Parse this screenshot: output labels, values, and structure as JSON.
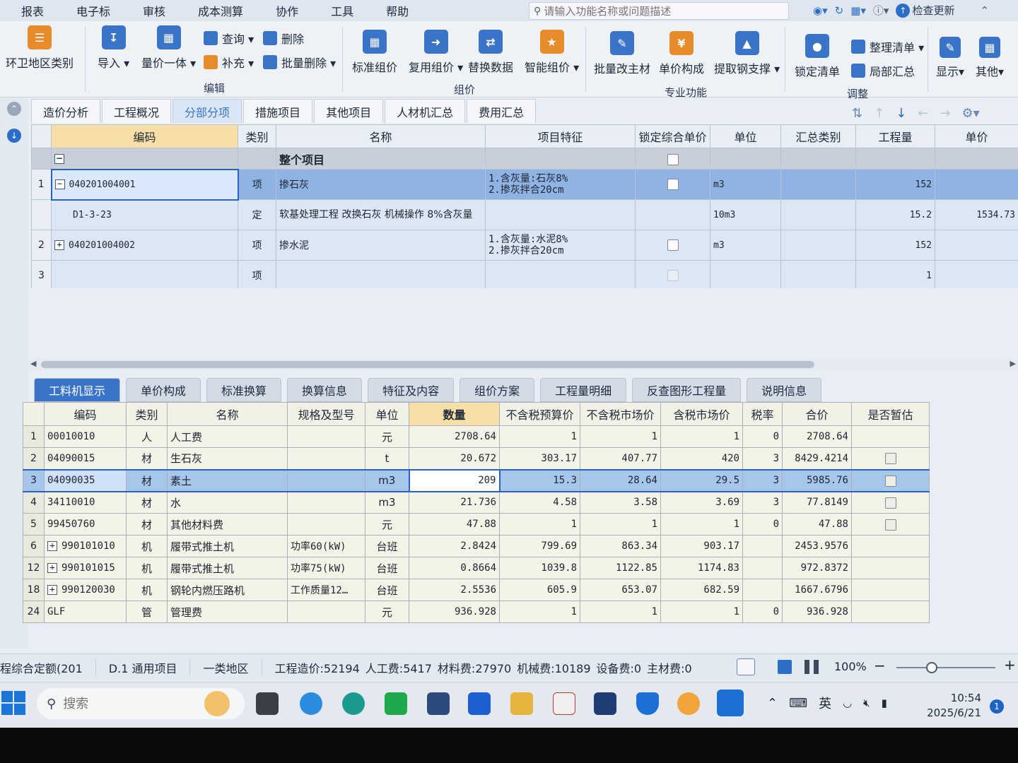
{
  "menu": [
    "报表",
    "电子标",
    "审核",
    "成本测算",
    "协作",
    "工具",
    "帮助"
  ],
  "search": {
    "placeholder": "请输入功能名称或问题描述"
  },
  "topright": {
    "check_update": "检查更新"
  },
  "ribbon": {
    "region_category": "环卫地区类别",
    "import": "导入",
    "quantity_price": "量价一体",
    "query": "查询",
    "supplement": "补充",
    "delete": "删除",
    "batch_delete": "批量删除",
    "group_edit": "编辑",
    "standard_price": "标准组价",
    "reuse_price": "复用组价",
    "replace_data": "替换数据",
    "smart_price": "智能组价",
    "group_price": "组价",
    "batch_main_material": "批量改主材",
    "unit_price_composition": "单价构成",
    "extract_rebar": "提取钢支撑",
    "group_professional": "专业功能",
    "lock_list": "锁定清单",
    "organize_list": "整理清单",
    "partial_summary": "局部汇总",
    "group_adjust": "调整",
    "display": "显示",
    "other": "其他"
  },
  "main_tabs": [
    "造价分析",
    "工程概况",
    "分部分项",
    "措施项目",
    "其他项目",
    "人材机汇总",
    "费用汇总"
  ],
  "upper_grid": {
    "headers": [
      "编码",
      "类别",
      "名称",
      "项目特征",
      "锁定综合单价",
      "单位",
      "汇总类别",
      "工程量",
      "单价"
    ],
    "whole_project": "整个项目",
    "rows": [
      {
        "no": "1",
        "code": "040201004001",
        "type": "项",
        "name": "掺石灰",
        "feature1": "1.含灰量:石灰8%",
        "feature2": "2.掺灰拌合20cm",
        "unit": "m3",
        "qty": "152",
        "price": ""
      },
      {
        "no": "",
        "code": "D1-3-23",
        "type": "定",
        "name": "软基处理工程 改换石灰 机械操作 8%含灰量",
        "feature1": "",
        "feature2": "",
        "unit": "10m3",
        "qty": "15.2",
        "price": "1534.73"
      },
      {
        "no": "2",
        "code": "040201004002",
        "type": "项",
        "name": "掺水泥",
        "feature1": "1.含灰量:水泥8%",
        "feature2": "2.掺灰拌合20cm",
        "unit": "m3",
        "qty": "152",
        "price": ""
      },
      {
        "no": "3",
        "code": "",
        "type": "项",
        "name": "",
        "feature1": "",
        "feature2": "",
        "unit": "",
        "qty": "1",
        "price": ""
      }
    ]
  },
  "bottom_tabs": [
    "工料机显示",
    "单价构成",
    "标准换算",
    "换算信息",
    "特征及内容",
    "组价方案",
    "工程量明细",
    "反查图形工程量",
    "说明信息"
  ],
  "lower_grid": {
    "headers": [
      "编码",
      "类别",
      "名称",
      "规格及型号",
      "单位",
      "数量",
      "不含税预算价",
      "不含税市场价",
      "含税市场价",
      "税率",
      "合价",
      "是否暂估"
    ],
    "rows": [
      {
        "no": "1",
        "code": "00010010",
        "type": "人",
        "name": "人工费",
        "spec": "",
        "unit": "元",
        "qty": "2708.64",
        "budget": "1",
        "market": "1",
        "taxed": "1",
        "rate": "0",
        "total": "2708.64"
      },
      {
        "no": "2",
        "code": "04090015",
        "type": "材",
        "name": "生石灰",
        "spec": "",
        "unit": "t",
        "qty": "20.672",
        "budget": "303.17",
        "market": "407.77",
        "taxed": "420",
        "rate": "3",
        "total": "8429.4214"
      },
      {
        "no": "3",
        "code": "04090035",
        "type": "材",
        "name": "素土",
        "spec": "",
        "unit": "m3",
        "qty": "209",
        "budget": "15.3",
        "market": "28.64",
        "taxed": "29.5",
        "rate": "3",
        "total": "5985.76"
      },
      {
        "no": "4",
        "code": "34110010",
        "type": "材",
        "name": "水",
        "spec": "",
        "unit": "m3",
        "qty": "21.736",
        "budget": "4.58",
        "market": "3.58",
        "taxed": "3.69",
        "rate": "3",
        "total": "77.8149"
      },
      {
        "no": "5",
        "code": "99450760",
        "type": "材",
        "name": "其他材料费",
        "spec": "",
        "unit": "元",
        "qty": "47.88",
        "budget": "1",
        "market": "1",
        "taxed": "1",
        "rate": "0",
        "total": "47.88"
      },
      {
        "no": "6",
        "code": "990101010",
        "type": "机",
        "name": "履带式推土机",
        "spec": "功率60(kW)",
        "unit": "台班",
        "qty": "2.8424",
        "budget": "799.69",
        "market": "863.34",
        "taxed": "903.17",
        "rate": "",
        "total": "2453.9576"
      },
      {
        "no": "12",
        "code": "990101015",
        "type": "机",
        "name": "履带式推土机",
        "spec": "功率75(kW)",
        "unit": "台班",
        "qty": "0.8664",
        "budget": "1039.8",
        "market": "1122.85",
        "taxed": "1174.83",
        "rate": "",
        "total": "972.8372"
      },
      {
        "no": "18",
        "code": "990120030",
        "type": "机",
        "name": "钢轮内燃压路机",
        "spec": "工作质量12…",
        "unit": "台班",
        "qty": "2.5536",
        "budget": "605.9",
        "market": "653.07",
        "taxed": "682.59",
        "rate": "",
        "total": "1667.6796"
      },
      {
        "no": "24",
        "code": "GLF",
        "type": "管",
        "name": "管理费",
        "spec": "",
        "unit": "元",
        "qty": "936.928",
        "budget": "1",
        "market": "1",
        "taxed": "1",
        "rate": "0",
        "total": "936.928"
      }
    ]
  },
  "status": {
    "quota": "程综合定额(201",
    "project_type": "D.1 通用项目",
    "region": "一类地区",
    "cost": "工程造价:52194",
    "labor": "人工费:5417",
    "material": "材料费:27970",
    "machine": "机械费:10189",
    "equipment": "设备费:0",
    "main_material": "主材费:0",
    "zoom": "100%"
  },
  "taskbar": {
    "search": "搜索",
    "ime": "英",
    "time": "10:54",
    "date": "2025/6/21",
    "notifications": "1"
  }
}
